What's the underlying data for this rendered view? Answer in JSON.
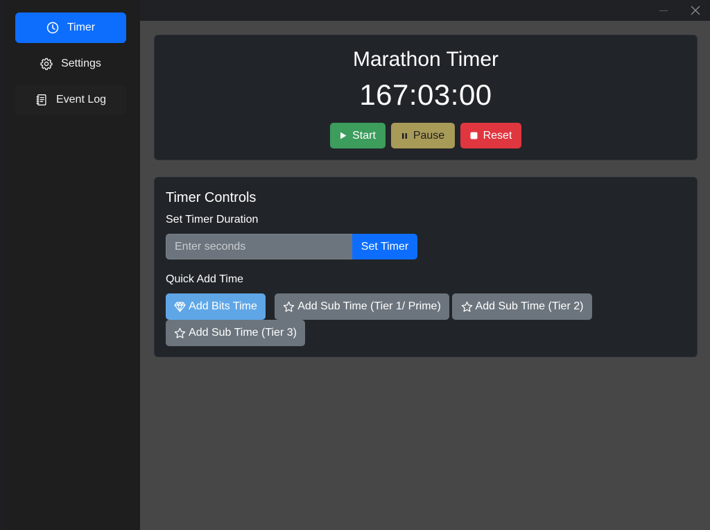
{
  "sidebar": {
    "items": [
      {
        "label": "Timer",
        "icon": "clock-icon",
        "active": true
      },
      {
        "label": "Settings",
        "icon": "gear-icon",
        "active": false
      },
      {
        "label": "Event Log",
        "icon": "journal-icon",
        "active": false
      }
    ]
  },
  "window": {
    "minimize_icon": "minimize-icon",
    "close_icon": "close-icon"
  },
  "timer": {
    "title": "Marathon Timer",
    "display": "167:03:00",
    "start_label": "Start",
    "pause_label": "Pause",
    "reset_label": "Reset"
  },
  "controls": {
    "title": "Timer Controls",
    "duration_label": "Set Timer Duration",
    "input_placeholder": "Enter seconds",
    "input_value": "",
    "set_button_label": "Set Timer",
    "quick_add_label": "Quick Add Time",
    "quick_buttons": [
      {
        "label": "Add Bits Time",
        "icon": "gem-icon"
      },
      {
        "label": "Add Sub Time (Tier 1/ Prime)",
        "icon": "star-icon"
      },
      {
        "label": "Add Sub Time (Tier 2)",
        "icon": "star-icon"
      },
      {
        "label": "Add Sub Time (Tier 3)",
        "icon": "star-icon"
      }
    ]
  },
  "colors": {
    "primary": "#0d6efd",
    "success": "#3c9d5c",
    "warning": "#a89a57",
    "danger": "#e0363f",
    "info": "#5fa6e6",
    "secondary": "#6c757d",
    "card": "#212529",
    "sidebar": "#1e1e1e",
    "content_bg": "#474747"
  }
}
